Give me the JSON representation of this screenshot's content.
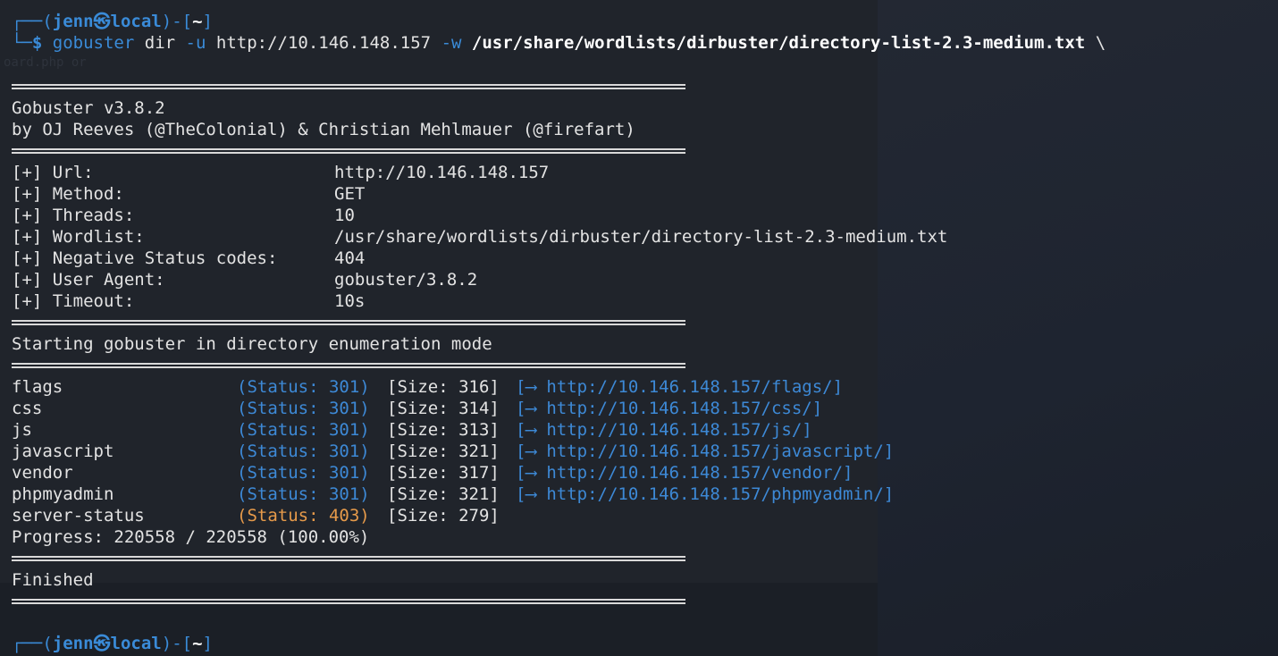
{
  "prompt": {
    "frame_open": "┌──(",
    "user": "jenn",
    "at_symbol": "㉿",
    "host": "local",
    "frame_mid": ")-[",
    "cwd": "~",
    "frame_close": "]",
    "frame_down": "└─",
    "dollar": "$"
  },
  "command": {
    "tool": "gobuster",
    "sub": "dir",
    "flag_u": "-u",
    "target": "http://10.146.148.157",
    "flag_w": "-w",
    "wordlist": "/usr/share/wordlists/dirbuster/directory-list-2.3-medium.txt",
    "continuation": "\\"
  },
  "ghost_text": "oard.php or",
  "banner": {
    "version": "Gobuster v3.8.2",
    "authors": "by OJ Reeves (@TheColonial) & Christian Mehlmauer (@firefart)"
  },
  "config": [
    {
      "label": "[+] Url:",
      "value": "http://10.146.148.157"
    },
    {
      "label": "[+] Method:",
      "value": "GET"
    },
    {
      "label": "[+] Threads:",
      "value": "10"
    },
    {
      "label": "[+] Wordlist:",
      "value": "/usr/share/wordlists/dirbuster/directory-list-2.3-medium.txt"
    },
    {
      "label": "[+] Negative Status codes:",
      "value": "404"
    },
    {
      "label": "[+] User Agent:",
      "value": "gobuster/3.8.2"
    },
    {
      "label": "[+] Timeout:",
      "value": "10s"
    }
  ],
  "mode_line": "Starting gobuster in directory enumeration mode",
  "results": [
    {
      "path": "flags",
      "status": "(Status: 301)",
      "size": "[Size: 316]",
      "redirect": "[⟶ http://10.146.148.157/flags/]"
    },
    {
      "path": "css",
      "status": "(Status: 301)",
      "size": "[Size: 314]",
      "redirect": "[⟶ http://10.146.148.157/css/]"
    },
    {
      "path": "js",
      "status": "(Status: 301)",
      "size": "[Size: 313]",
      "redirect": "[⟶ http://10.146.148.157/js/]"
    },
    {
      "path": "javascript",
      "status": "(Status: 301)",
      "size": "[Size: 321]",
      "redirect": "[⟶ http://10.146.148.157/javascript/]"
    },
    {
      "path": "vendor",
      "status": "(Status: 301)",
      "size": "[Size: 317]",
      "redirect": "[⟶ http://10.146.148.157/vendor/]"
    },
    {
      "path": "phpmyadmin",
      "status": "(Status: 301)",
      "size": "[Size: 321]",
      "redirect": "[⟶ http://10.146.148.157/phpmyadmin/]"
    },
    {
      "path": "server-status",
      "status": "(Status: 403)",
      "size": "[Size: 279]",
      "redirect": ""
    }
  ],
  "progress": "Progress: 220558 / 220558 (100.00%)",
  "finished": "Finished",
  "colors": {
    "background": "#1b1f26",
    "text": "#e3e3e3",
    "prompt_blue": "#3a8bd8",
    "status_301": "#3d89d6",
    "status_403": "#e69a4a"
  }
}
